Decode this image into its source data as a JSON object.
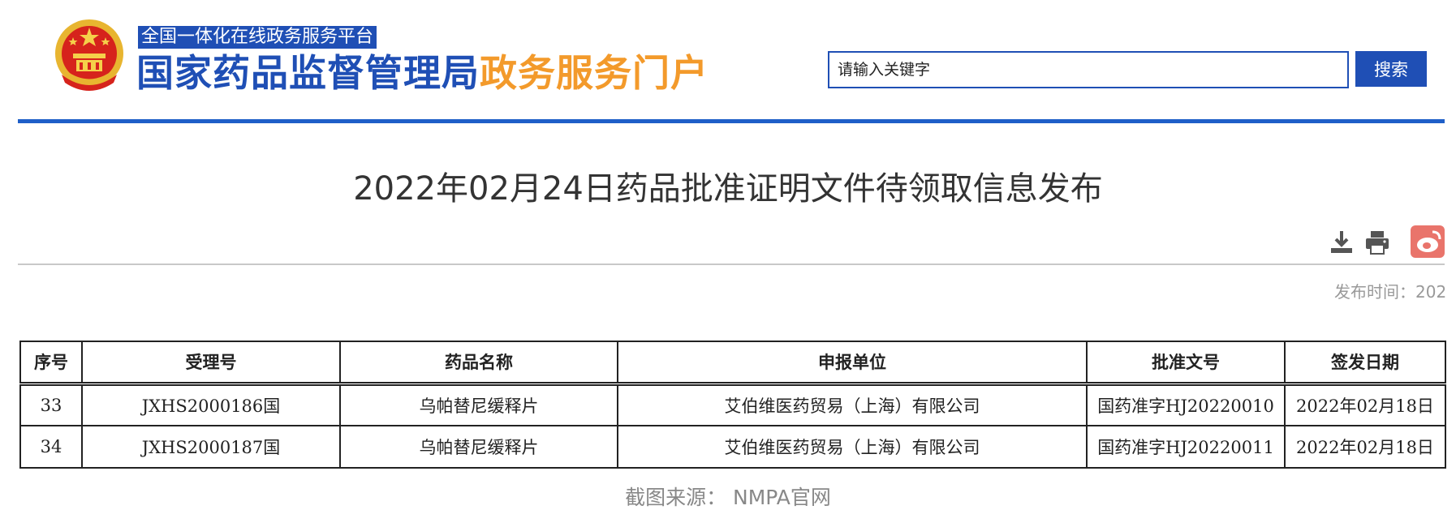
{
  "header": {
    "platform_tag": "全国一体化在线政务服务平台",
    "title_part1": "国家药品监督管理局",
    "title_part2": "政务服务门户",
    "search_placeholder": "请输入关键字",
    "search_button": "搜索",
    "colors": {
      "brand_blue": "#1f4fb5",
      "accent_orange": "#f39a2b"
    }
  },
  "article": {
    "title": "2022年02月24日药品批准证明文件待领取信息发布",
    "publish_time": "发布时间：202",
    "tools": [
      "download-icon",
      "print-icon",
      "weibo-icon"
    ]
  },
  "table": {
    "columns": [
      "序号",
      "受理号",
      "药品名称",
      "申报单位",
      "批准文号",
      "签发日期"
    ],
    "rows": [
      [
        "33",
        "JXHS2000186国",
        "乌帕替尼缓释片",
        "艾伯维医药贸易（上海）有限公司",
        "国药准字HJ20220010",
        "2022年02月18日"
      ],
      [
        "34",
        "JXHS2000187国",
        "乌帕替尼缓释片",
        "艾伯维医药贸易（上海）有限公司",
        "国药准字HJ20220011",
        "2022年02月18日"
      ]
    ]
  },
  "caption": "截图来源： NMPA官网"
}
